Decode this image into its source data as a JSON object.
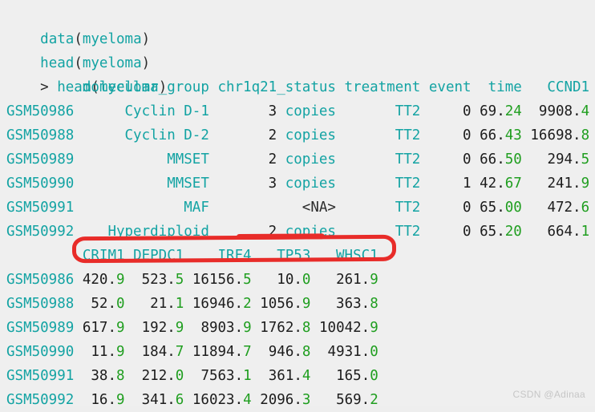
{
  "console": {
    "background_color": "#efefef",
    "teal_color": "#13a3a3",
    "green_color": "#1f9e1f",
    "dark_color": "#1c1c1c",
    "annotation_color": "#e82c29",
    "code_lines": [
      {
        "fn": "data",
        "open": "(",
        "arg": "myeloma",
        "close": ")"
      },
      {
        "fn": "head",
        "open": "(",
        "arg": "myeloma",
        "close": ")"
      }
    ],
    "prompt_line": {
      "prompt": "> ",
      "fn": "head",
      "open": "(",
      "arg": "myeloma",
      "close": ")"
    }
  },
  "table_block_1": {
    "headers": [
      "molecular_group",
      "chr1q21_status",
      "treatment",
      "event",
      "time",
      "CCND1"
    ],
    "row_names": [
      "GSM50986",
      "GSM50988",
      "GSM50989",
      "GSM50990",
      "GSM50991",
      "GSM50992"
    ],
    "rows": [
      {
        "molecular_group": "Cyclin D-1",
        "chr1q21_status": "3 copies",
        "treatment": "TT2",
        "event": "0",
        "time": "69.24",
        "CCND1": "9908.4"
      },
      {
        "molecular_group": "Cyclin D-2",
        "chr1q21_status": "2 copies",
        "treatment": "TT2",
        "event": "0",
        "time": "66.43",
        "CCND1": "16698.8"
      },
      {
        "molecular_group": "MMSET",
        "chr1q21_status": "2 copies",
        "treatment": "TT2",
        "event": "0",
        "time": "66.50",
        "CCND1": "294.5"
      },
      {
        "molecular_group": "MMSET",
        "chr1q21_status": "3 copies",
        "treatment": "TT2",
        "event": "1",
        "time": "42.67",
        "CCND1": "241.9"
      },
      {
        "molecular_group": "MAF",
        "chr1q21_status": "<NA>",
        "treatment": "TT2",
        "event": "0",
        "time": "65.00",
        "CCND1": "472.6"
      },
      {
        "molecular_group": "Hyperdiploid",
        "chr1q21_status": "2 copies",
        "treatment": "TT2",
        "event": "0",
        "time": "65.20",
        "CCND1": "664.1"
      }
    ]
  },
  "table_block_2": {
    "headers": [
      "CRIM1",
      "DEPDC1",
      "IRF4",
      "TP53",
      "WHSC1"
    ],
    "row_names": [
      "GSM50986",
      "GSM50988",
      "GSM50989",
      "GSM50990",
      "GSM50991",
      "GSM50992"
    ],
    "rows": [
      {
        "CRIM1": "420.9",
        "DEPDC1": "523.5",
        "IRF4": "16156.5",
        "TP53": "10.0",
        "WHSC1": "261.9"
      },
      {
        "CRIM1": "52.0",
        "DEPDC1": "21.1",
        "IRF4": "16946.2",
        "TP53": "1056.9",
        "WHSC1": "363.8"
      },
      {
        "CRIM1": "617.9",
        "DEPDC1": "192.9",
        "IRF4": "8903.9",
        "TP53": "1762.8",
        "WHSC1": "10042.9"
      },
      {
        "CRIM1": "11.9",
        "DEPDC1": "184.7",
        "IRF4": "11894.7",
        "TP53": "946.8",
        "WHSC1": "4931.0"
      },
      {
        "CRIM1": "38.8",
        "DEPDC1": "212.0",
        "IRF4": "7563.1",
        "TP53": "361.4",
        "WHSC1": "165.0"
      },
      {
        "CRIM1": "16.9",
        "DEPDC1": "341.6",
        "IRF4": "16023.4",
        "TP53": "2096.3",
        "WHSC1": "569.2"
      }
    ]
  },
  "annotation": {
    "label": "red-highlight-box-around-gene-headers",
    "color": "#e82c29"
  },
  "watermark": {
    "text": "CSDN @Adinaa"
  }
}
